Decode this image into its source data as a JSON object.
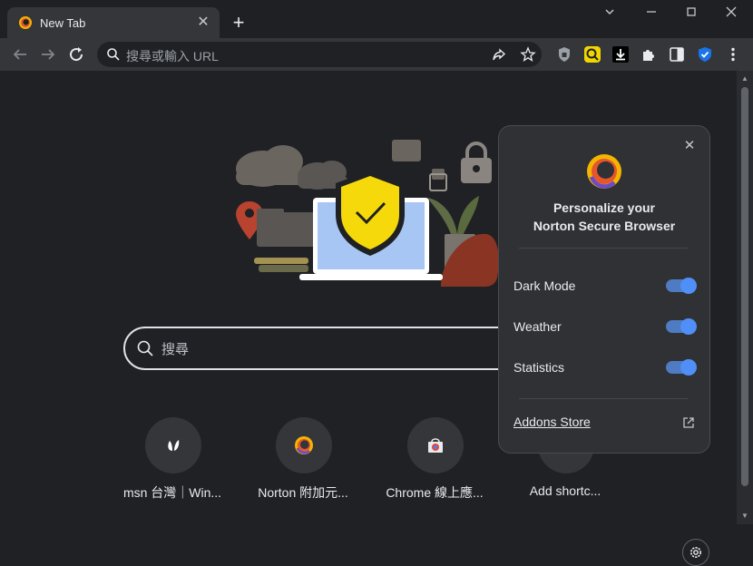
{
  "tab": {
    "title": "New Tab",
    "close": "✕"
  },
  "new_tab": "+",
  "window": {
    "minimize": "⌄",
    "min": "—",
    "max": "☐",
    "close": "✕"
  },
  "omnibox": {
    "placeholder": "搜尋或輸入 URL"
  },
  "search": {
    "placeholder": "搜尋"
  },
  "shortcuts": [
    {
      "label": "msn 台灣｜Win..."
    },
    {
      "label": "Norton 附加元..."
    },
    {
      "label": "Chrome 線上應..."
    },
    {
      "label": "Add shortc..."
    }
  ],
  "panel": {
    "title_line1": "Personalize your",
    "title_line2": "Norton Secure Browser",
    "rows": [
      {
        "label": "Dark Mode",
        "on": true
      },
      {
        "label": "Weather",
        "on": true
      },
      {
        "label": "Statistics",
        "on": true
      }
    ],
    "addons_label": "Addons Store",
    "close": "✕"
  },
  "colors": {
    "accent_toggle": "#4f8ff7",
    "bg": "#202124",
    "panel": "#303134"
  }
}
